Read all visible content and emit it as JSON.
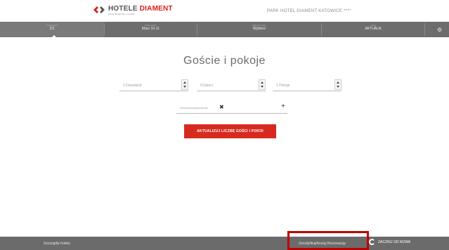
{
  "header": {
    "logo_part1": "HOTELE",
    "logo_part2": "DIAMENT",
    "logo_tagline": "hotele dla biznesu i turystów",
    "hotel_name": "PARK HOTEL DIAMENT KATOWICE ****"
  },
  "steps": [
    {
      "caption": "Liczba gości",
      "value": "2/1",
      "active": true
    },
    {
      "caption": "Data pobytu",
      "value": "Marz 10-11",
      "active": false
    },
    {
      "caption": "Wybrany pokój",
      "value": "Wybierz",
      "active": false
    },
    {
      "caption": "Cena",
      "value": "AKTUALN",
      "active": false
    }
  ],
  "main": {
    "title": "Goście i pokoje",
    "adults": "2 Dorosłych",
    "children": "0 Dzieci",
    "rooms": "1 Pokoje",
    "room_tag": "Dwuosobowy/Łazienki",
    "remove_symbol": "✖",
    "add_symbol": "+",
    "update_button": "AKTUALIZUJ LICZBĘ GOŚCI I POKOI"
  },
  "footer": {
    "back_link": "Szczegóły hotelu",
    "modify_link": "Zmodyfikuj/Anuluj Rezerwację",
    "next_label": "ZACZNIJ OD NOWA"
  },
  "icons": {
    "settings": "gear-icon",
    "remove": "close-icon",
    "add": "plus-icon",
    "spinner": "chevron-up-down-icon",
    "logo": "diamond-logo-icon",
    "restart": "refresh-icon"
  },
  "colors": {
    "accent": "#d72a1e",
    "bar": "#6d6d6d",
    "highlight": "#c00000"
  }
}
